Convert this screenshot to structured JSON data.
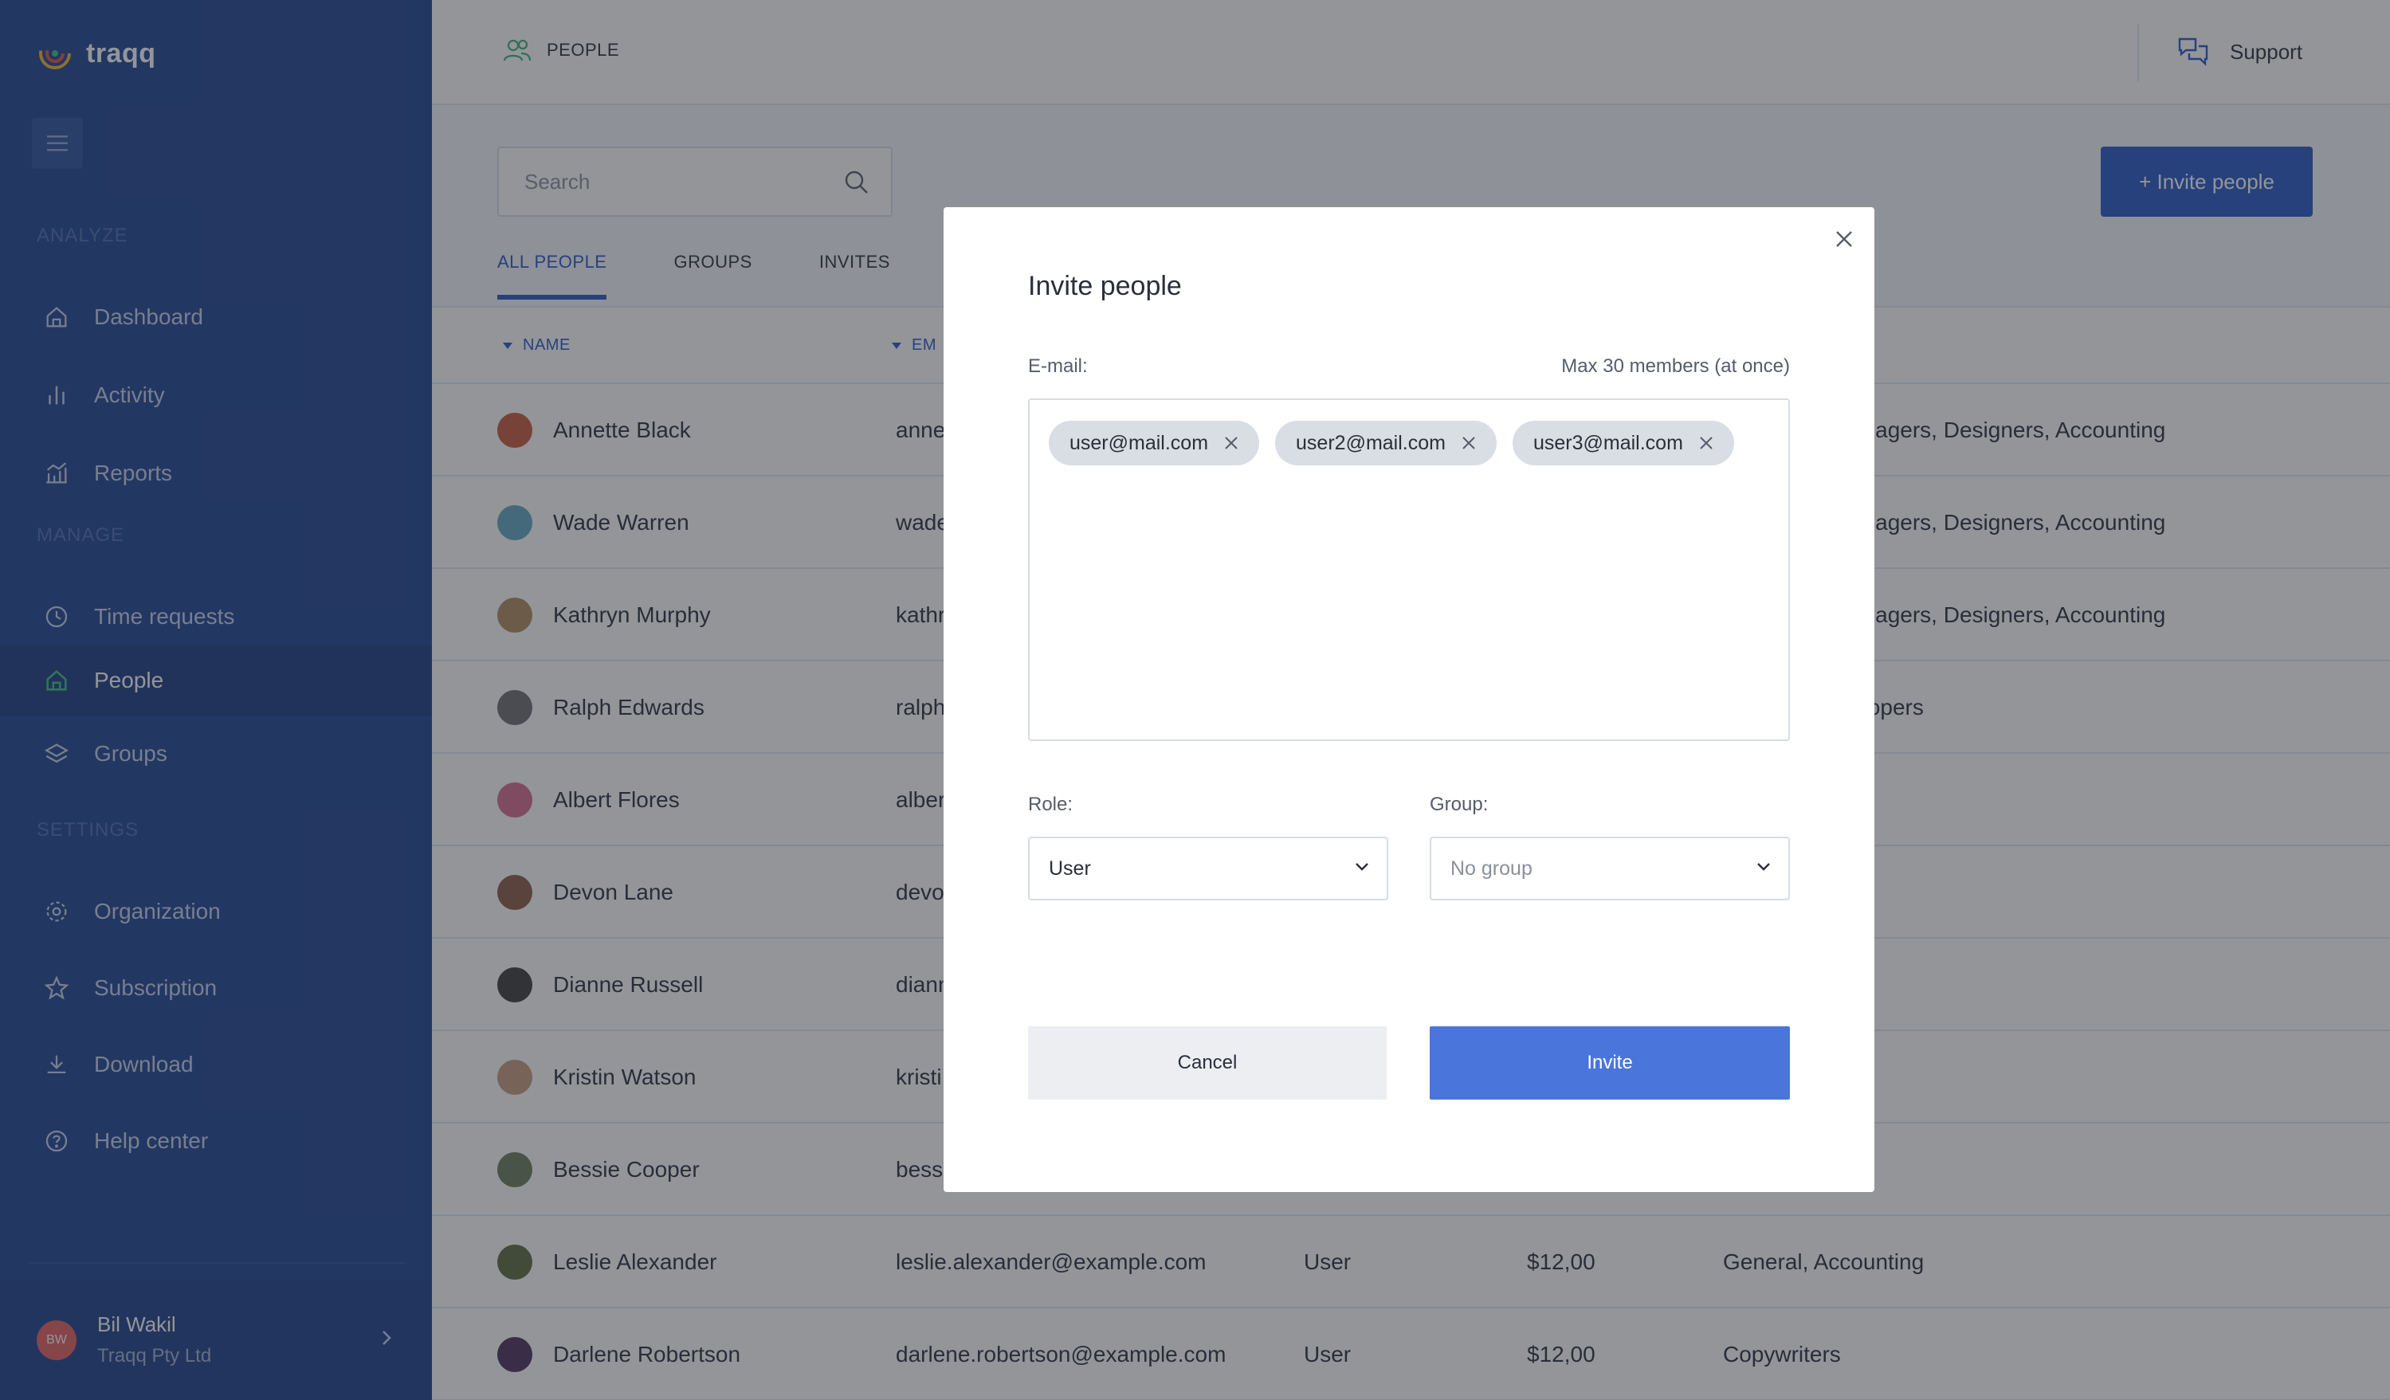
{
  "app": {
    "brand": "traqq"
  },
  "sidebar": {
    "section_analyze": "ANALYZE",
    "section_manage": "MANAGE",
    "section_settings": "SETTINGS",
    "items": [
      {
        "label": "Dashboard",
        "icon": "home-icon"
      },
      {
        "label": "Activity",
        "icon": "bar-chart-icon"
      },
      {
        "label": "Reports",
        "icon": "reports-icon"
      },
      {
        "label": "Time requests",
        "icon": "clock-icon"
      },
      {
        "label": "People",
        "icon": "people-icon",
        "active": true
      },
      {
        "label": "Groups",
        "icon": "layers-icon"
      },
      {
        "label": "Organization",
        "icon": "gear-icon"
      },
      {
        "label": "Subscription",
        "icon": "star-icon"
      },
      {
        "label": "Download",
        "icon": "download-icon"
      },
      {
        "label": "Help center",
        "icon": "help-icon"
      }
    ],
    "user": {
      "initials": "BW",
      "name": "Bil Wakil",
      "org": "Traqq Pty Ltd"
    }
  },
  "topbar": {
    "title": "PEOPLE",
    "support": "Support"
  },
  "toolbar": {
    "search_placeholder": "Search",
    "invite_button": "+ Invite people"
  },
  "tabs": [
    "ALL PEOPLE",
    "GROUPS",
    "INVITES"
  ],
  "table": {
    "headers": {
      "name": "NAME",
      "email": "EM"
    },
    "rows": [
      {
        "name": "Annette Black",
        "email": "anne",
        "role": "",
        "rate": "",
        "groups": "anagers, Designers, Accounting"
      },
      {
        "name": "Wade Warren",
        "email": "wade",
        "role": "",
        "rate": "",
        "groups": "anagers, Designers, Accounting"
      },
      {
        "name": "Kathryn Murphy",
        "email": "kathr",
        "role": "",
        "rate": "",
        "groups": "anagers, Designers, Accounting"
      },
      {
        "name": "Ralph Edwards",
        "email": "ralph",
        "role": "",
        "rate": "",
        "groups": "elopers"
      },
      {
        "name": "Albert Flores",
        "email": "alber",
        "role": "",
        "rate": "",
        "groups": ""
      },
      {
        "name": "Devon Lane",
        "email": "devo",
        "role": "",
        "rate": "",
        "groups": ""
      },
      {
        "name": "Dianne Russell",
        "email": "diann",
        "role": "",
        "rate": "",
        "groups": ""
      },
      {
        "name": "Kristin Watson",
        "email": "kristi",
        "role": "",
        "rate": "",
        "groups": ""
      },
      {
        "name": "Bessie Cooper",
        "email": "bessi",
        "role": "",
        "rate": "",
        "groups": ""
      },
      {
        "name": "Leslie Alexander",
        "email": "leslie.alexander@example.com",
        "role": "User",
        "rate": "$12,00",
        "groups": "General, Accounting"
      },
      {
        "name": "Darlene Robertson",
        "email": "darlene.robertson@example.com",
        "role": "User",
        "rate": "$12,00",
        "groups": "Copywriters"
      }
    ]
  },
  "modal": {
    "title": "Invite people",
    "email_label": "E-mail:",
    "max_label": "Max 30 members (at once)",
    "emails": [
      "user@mail.com",
      "user2@mail.com",
      "user3@mail.com"
    ],
    "role_label": "Role:",
    "role_value": "User",
    "group_label": "Group:",
    "group_value": "No group",
    "cancel": "Cancel",
    "invite": "Invite"
  },
  "colors": {
    "sidebar": "#1f4393",
    "accent": "#2457c5",
    "invite_button": "#4a76dc"
  }
}
